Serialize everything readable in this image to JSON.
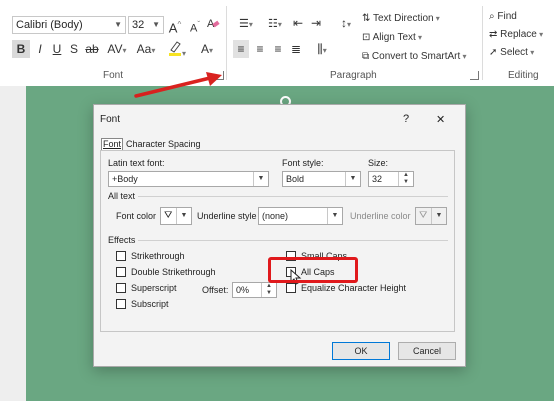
{
  "ribbon": {
    "font_name": "Calibri (Body)",
    "font_size": "32",
    "font_group_label": "Font",
    "paragraph_group_label": "Paragraph",
    "editing_group_label": "Editing",
    "text_direction_label": "Text Direction",
    "align_text_label": "Align Text",
    "convert_smartart_label": "Convert to SmartArt",
    "find_label": "Find",
    "replace_label": "Replace",
    "select_label": "Select",
    "bold_glyph": "B",
    "italic_glyph": "I",
    "underline_glyph": "U",
    "shadow_glyph": "S",
    "strike_glyph": "ab",
    "spacing_glyph": "AV",
    "case_glyph": "Aa",
    "grow_glyph": "A",
    "shrink_glyph": "A",
    "fontcolor_glyph": "A"
  },
  "dialog": {
    "title": "Font",
    "help": "?",
    "close": "✕",
    "tabs": [
      "Font",
      "Character Spacing"
    ],
    "latin_font_label": "Latin text font:",
    "latin_font_value": "+Body",
    "font_style_label": "Font style:",
    "font_style_value": "Bold",
    "size_label": "Size:",
    "size_value": "32",
    "all_text_label": "All text",
    "font_color_label": "Font color",
    "underline_style_label": "Underline style",
    "underline_style_value": "(none)",
    "underline_color_label": "Underline color",
    "effects_label": "Effects",
    "effects_left": [
      "Strikethrough",
      "Double Strikethrough",
      "Superscript",
      "Subscript"
    ],
    "offset_label": "Offset:",
    "offset_value": "0%",
    "effects_right": [
      "Small Caps",
      "All Caps",
      "Equalize Character Height"
    ],
    "ok_label": "OK",
    "cancel_label": "Cancel"
  },
  "colors": {
    "slide_background": "#6aa782",
    "highlight_box": "#e0191c",
    "arrow": "#d9221f"
  }
}
